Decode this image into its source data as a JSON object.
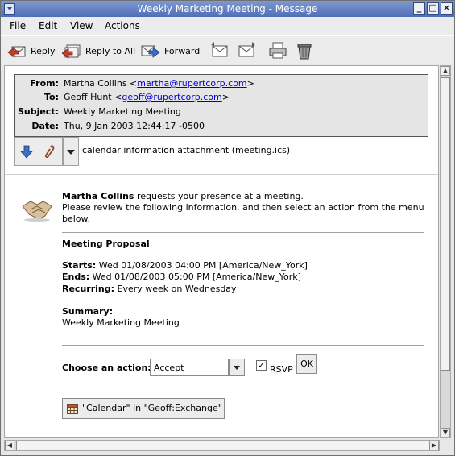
{
  "window": {
    "title": "Weekly Marketing Meeting - Message"
  },
  "menubar": {
    "items": [
      "File",
      "Edit",
      "View",
      "Actions"
    ]
  },
  "toolbar": {
    "reply": "Reply",
    "reply_all": "Reply to All",
    "forward": "Forward"
  },
  "headers": {
    "from_label": "From:",
    "from_name": "Martha Collins <",
    "from_email": "martha@rupertcorp.com",
    "from_close": ">",
    "to_label": "To:",
    "to_name": "Geoff Hunt <",
    "to_email": "geoff@rupertcorp.com",
    "to_close": ">",
    "subject_label": "Subject:",
    "subject": "Weekly Marketing Meeting",
    "date_label": "Date:",
    "date": "Thu, 9 Jan 2003 12:44:17 -0500"
  },
  "attachment": {
    "name": "calendar information attachment (meeting.ics)"
  },
  "invite": {
    "organizer": "Martha Collins",
    "request": " requests your presence at a meeting.",
    "instructions_line1": "Please review the following information, and then select an action from the menu",
    "instructions_line2": "below.",
    "proposal_heading": "Meeting Proposal",
    "starts_label": "Starts:",
    "starts": " Wed 01/08/2003 04:00 PM [America/New_York]",
    "ends_label": "Ends:",
    "ends": " Wed 01/08/2003 05:00 PM [America/New_York]",
    "recurring_label": "Recurring:",
    "recurring": " Every week on Wednesday",
    "summary_label": "Summary:",
    "summary": "Weekly Marketing Meeting"
  },
  "action": {
    "label": "Choose an action:",
    "selected": "Accept",
    "rsvp_label": "RSVP",
    "rsvp_checked": "✓",
    "ok_label": "OK"
  },
  "calendar_button": {
    "label": "\"Calendar\" in \"Geoff:Exchange\""
  }
}
